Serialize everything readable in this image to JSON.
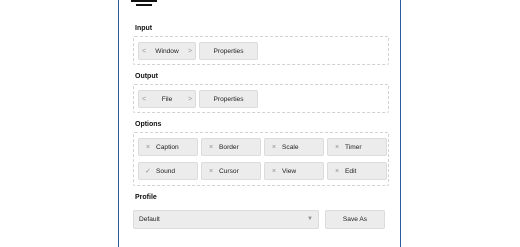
{
  "sections": {
    "input": {
      "label": "Input",
      "selector": {
        "prev_glyph": "<",
        "value": "Window",
        "next_glyph": ">"
      },
      "properties_label": "Properties"
    },
    "output": {
      "label": "Output",
      "selector": {
        "prev_glyph": "<",
        "value": "File",
        "next_glyph": ">"
      },
      "properties_label": "Properties"
    },
    "options": {
      "label": "Options",
      "items": [
        {
          "label": "Caption",
          "state": "off",
          "mark": "×"
        },
        {
          "label": "Border",
          "state": "off",
          "mark": "×"
        },
        {
          "label": "Scale",
          "state": "off",
          "mark": "×"
        },
        {
          "label": "Timer",
          "state": "off",
          "mark": "×"
        },
        {
          "label": "Sound",
          "state": "on",
          "mark": "✓"
        },
        {
          "label": "Cursor",
          "state": "off",
          "mark": "×"
        },
        {
          "label": "View",
          "state": "off",
          "mark": "×"
        },
        {
          "label": "Edit",
          "state": "off",
          "mark": "×"
        }
      ]
    },
    "profile": {
      "label": "Profile",
      "selected": "Default",
      "dropdown_glyph": "▼",
      "save_as_label": "Save As"
    }
  },
  "icons": {
    "app": "monitor-icon",
    "off_mark": "x-mark-icon",
    "on_mark": "checkmark-icon"
  },
  "colors": {
    "frame_border": "#2a5d99",
    "button_bg": "#ececec",
    "group_border": "#cfd3d8"
  }
}
